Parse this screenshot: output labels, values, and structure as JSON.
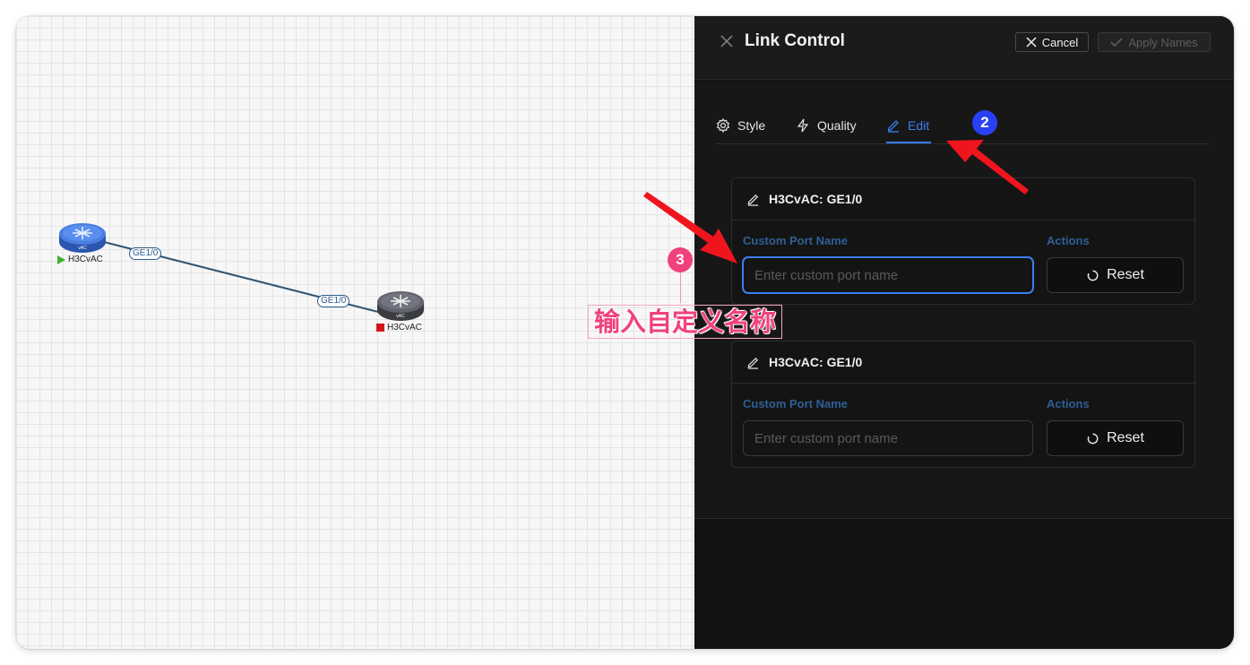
{
  "canvas": {
    "nodes": [
      {
        "label": "H3CvAC",
        "device_text": "vAC",
        "status": "running",
        "color": "#3f6ed4"
      },
      {
        "label": "H3CvAC",
        "device_text": "vAC",
        "status": "stopped",
        "color": "#5a5d66"
      }
    ],
    "link": {
      "port_a": "GE1/0",
      "port_b": "GE1/0",
      "color": "#2f5573"
    }
  },
  "panel": {
    "title": "Link Control",
    "cancel_label": "Cancel",
    "apply_label": "Apply Names",
    "tabs": [
      {
        "label": "Style",
        "icon": "gear-icon",
        "active": false
      },
      {
        "label": "Quality",
        "icon": "lightning-icon",
        "active": false
      },
      {
        "label": "Edit",
        "icon": "pencil-icon",
        "active": true
      }
    ],
    "cards": [
      {
        "title": "H3CvAC: GE1/0",
        "field_label": "Custom Port Name",
        "actions_label": "Actions",
        "placeholder": "Enter custom port name",
        "value": "",
        "focused": true,
        "reset_label": "Reset"
      },
      {
        "title": "H3CvAC: GE1/0",
        "field_label": "Custom Port Name",
        "actions_label": "Actions",
        "placeholder": "Enter custom port name",
        "value": "",
        "focused": false,
        "reset_label": "Reset"
      }
    ]
  },
  "annotations": {
    "step2": "2",
    "step3": "3",
    "step3_text": "输入自定义名称",
    "arrow_color": "#f0141e"
  },
  "colors": {
    "accent": "#3b7ef0",
    "field_label": "#2f5f96",
    "panel_bg": "#121212"
  }
}
